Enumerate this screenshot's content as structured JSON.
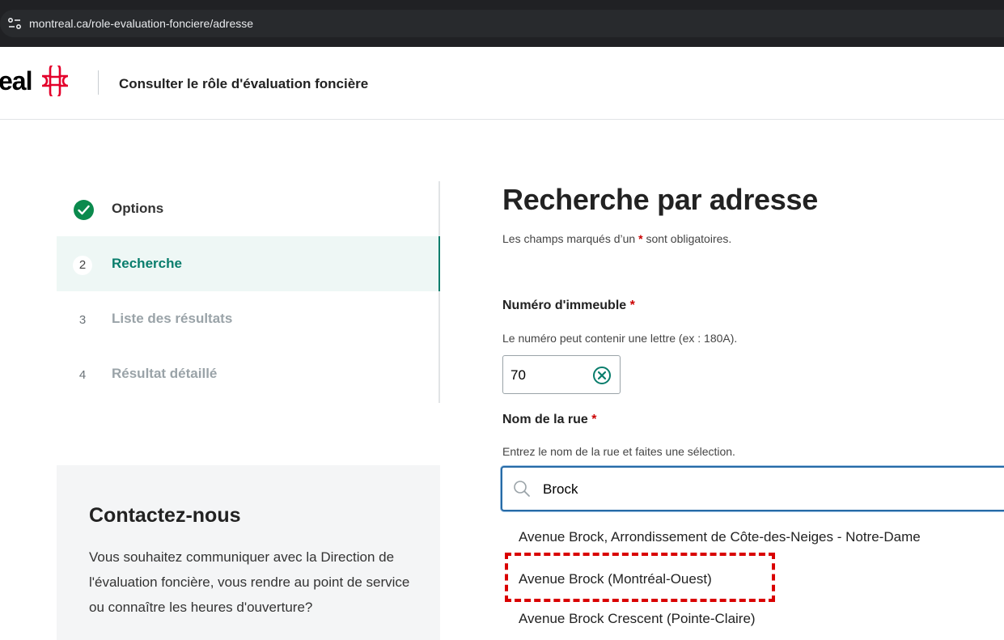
{
  "browser": {
    "url": "montreal.ca/role-evaluation-fonciere/adresse"
  },
  "header": {
    "logo_text": "eal",
    "title": "Consulter le rôle d'évaluation foncière"
  },
  "steps": [
    {
      "number": "",
      "label": "Options",
      "state": "done"
    },
    {
      "number": "2",
      "label": "Recherche",
      "state": "current"
    },
    {
      "number": "3",
      "label": "Liste des résultats",
      "state": "pending"
    },
    {
      "number": "4",
      "label": "Résultat détaillé",
      "state": "pending"
    }
  ],
  "contact": {
    "title": "Contactez-nous",
    "body": "Vous souhaitez communiquer avec la Direction de l'évaluation foncière, vous rendre au point de service ou connaître les heures d'ouverture?"
  },
  "main": {
    "title": "Recherche par adresse",
    "required_prefix": "Les champs marqués d’un",
    "required_star": "*",
    "required_suffix": "sont obligatoires."
  },
  "building_number": {
    "label": "Numéro d'immeuble",
    "star": "*",
    "help": "Le numéro peut contenir une lettre (ex : 180A).",
    "value": "70"
  },
  "street": {
    "label": "Nom de la rue",
    "star": "*",
    "help": "Entrez le nom de la rue et faites une sélection.",
    "value": "Brock"
  },
  "suggestions": [
    "Avenue Brock, Arrondissement de Côte-des-Neiges - Notre-Dame",
    "Avenue Brock (Montréal-Ouest)",
    "Avenue Brock Crescent (Pointe-Claire)"
  ],
  "colors": {
    "accent": "#097d6c",
    "check": "#0b8a4d",
    "required": "#cb0000",
    "focus": "#266aa6",
    "annotation": "#d90000",
    "logo_red": "#e4002b"
  }
}
